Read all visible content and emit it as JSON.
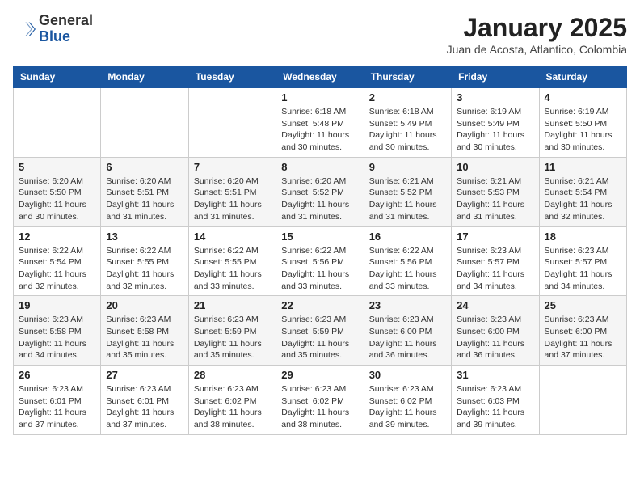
{
  "header": {
    "logo_line1": "General",
    "logo_line2": "Blue",
    "month": "January 2025",
    "location": "Juan de Acosta, Atlantico, Colombia"
  },
  "weekdays": [
    "Sunday",
    "Monday",
    "Tuesday",
    "Wednesday",
    "Thursday",
    "Friday",
    "Saturday"
  ],
  "weeks": [
    [
      {
        "day": "",
        "info": ""
      },
      {
        "day": "",
        "info": ""
      },
      {
        "day": "",
        "info": ""
      },
      {
        "day": "1",
        "info": "Sunrise: 6:18 AM\nSunset: 5:48 PM\nDaylight: 11 hours\nand 30 minutes."
      },
      {
        "day": "2",
        "info": "Sunrise: 6:18 AM\nSunset: 5:49 PM\nDaylight: 11 hours\nand 30 minutes."
      },
      {
        "day": "3",
        "info": "Sunrise: 6:19 AM\nSunset: 5:49 PM\nDaylight: 11 hours\nand 30 minutes."
      },
      {
        "day": "4",
        "info": "Sunrise: 6:19 AM\nSunset: 5:50 PM\nDaylight: 11 hours\nand 30 minutes."
      }
    ],
    [
      {
        "day": "5",
        "info": "Sunrise: 6:20 AM\nSunset: 5:50 PM\nDaylight: 11 hours\nand 30 minutes."
      },
      {
        "day": "6",
        "info": "Sunrise: 6:20 AM\nSunset: 5:51 PM\nDaylight: 11 hours\nand 31 minutes."
      },
      {
        "day": "7",
        "info": "Sunrise: 6:20 AM\nSunset: 5:51 PM\nDaylight: 11 hours\nand 31 minutes."
      },
      {
        "day": "8",
        "info": "Sunrise: 6:20 AM\nSunset: 5:52 PM\nDaylight: 11 hours\nand 31 minutes."
      },
      {
        "day": "9",
        "info": "Sunrise: 6:21 AM\nSunset: 5:52 PM\nDaylight: 11 hours\nand 31 minutes."
      },
      {
        "day": "10",
        "info": "Sunrise: 6:21 AM\nSunset: 5:53 PM\nDaylight: 11 hours\nand 31 minutes."
      },
      {
        "day": "11",
        "info": "Sunrise: 6:21 AM\nSunset: 5:54 PM\nDaylight: 11 hours\nand 32 minutes."
      }
    ],
    [
      {
        "day": "12",
        "info": "Sunrise: 6:22 AM\nSunset: 5:54 PM\nDaylight: 11 hours\nand 32 minutes."
      },
      {
        "day": "13",
        "info": "Sunrise: 6:22 AM\nSunset: 5:55 PM\nDaylight: 11 hours\nand 32 minutes."
      },
      {
        "day": "14",
        "info": "Sunrise: 6:22 AM\nSunset: 5:55 PM\nDaylight: 11 hours\nand 33 minutes."
      },
      {
        "day": "15",
        "info": "Sunrise: 6:22 AM\nSunset: 5:56 PM\nDaylight: 11 hours\nand 33 minutes."
      },
      {
        "day": "16",
        "info": "Sunrise: 6:22 AM\nSunset: 5:56 PM\nDaylight: 11 hours\nand 33 minutes."
      },
      {
        "day": "17",
        "info": "Sunrise: 6:23 AM\nSunset: 5:57 PM\nDaylight: 11 hours\nand 34 minutes."
      },
      {
        "day": "18",
        "info": "Sunrise: 6:23 AM\nSunset: 5:57 PM\nDaylight: 11 hours\nand 34 minutes."
      }
    ],
    [
      {
        "day": "19",
        "info": "Sunrise: 6:23 AM\nSunset: 5:58 PM\nDaylight: 11 hours\nand 34 minutes."
      },
      {
        "day": "20",
        "info": "Sunrise: 6:23 AM\nSunset: 5:58 PM\nDaylight: 11 hours\nand 35 minutes."
      },
      {
        "day": "21",
        "info": "Sunrise: 6:23 AM\nSunset: 5:59 PM\nDaylight: 11 hours\nand 35 minutes."
      },
      {
        "day": "22",
        "info": "Sunrise: 6:23 AM\nSunset: 5:59 PM\nDaylight: 11 hours\nand 35 minutes."
      },
      {
        "day": "23",
        "info": "Sunrise: 6:23 AM\nSunset: 6:00 PM\nDaylight: 11 hours\nand 36 minutes."
      },
      {
        "day": "24",
        "info": "Sunrise: 6:23 AM\nSunset: 6:00 PM\nDaylight: 11 hours\nand 36 minutes."
      },
      {
        "day": "25",
        "info": "Sunrise: 6:23 AM\nSunset: 6:00 PM\nDaylight: 11 hours\nand 37 minutes."
      }
    ],
    [
      {
        "day": "26",
        "info": "Sunrise: 6:23 AM\nSunset: 6:01 PM\nDaylight: 11 hours\nand 37 minutes."
      },
      {
        "day": "27",
        "info": "Sunrise: 6:23 AM\nSunset: 6:01 PM\nDaylight: 11 hours\nand 37 minutes."
      },
      {
        "day": "28",
        "info": "Sunrise: 6:23 AM\nSunset: 6:02 PM\nDaylight: 11 hours\nand 38 minutes."
      },
      {
        "day": "29",
        "info": "Sunrise: 6:23 AM\nSunset: 6:02 PM\nDaylight: 11 hours\nand 38 minutes."
      },
      {
        "day": "30",
        "info": "Sunrise: 6:23 AM\nSunset: 6:02 PM\nDaylight: 11 hours\nand 39 minutes."
      },
      {
        "day": "31",
        "info": "Sunrise: 6:23 AM\nSunset: 6:03 PM\nDaylight: 11 hours\nand 39 minutes."
      },
      {
        "day": "",
        "info": ""
      }
    ]
  ]
}
